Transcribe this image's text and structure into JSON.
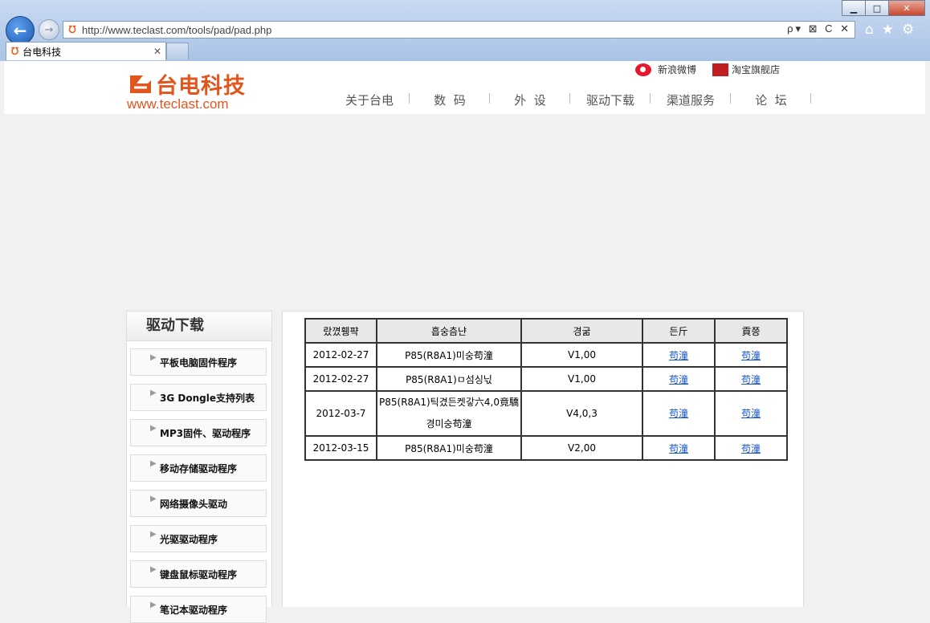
{
  "browser": {
    "url": "http://www.teclast.com/tools/pad/pad.php",
    "tab_title": "台电科技",
    "address_tools": "ρ▾ ⊠ C ✕",
    "window_controls": [
      "minimize",
      "maximize",
      "close"
    ]
  },
  "header": {
    "logo_cn": "台电科技",
    "logo_en": "www.teclast.com",
    "weibo": "新浪微博",
    "taobao": "淘宝旗舰店",
    "nav": [
      "关于台电",
      "数  码",
      "外  设",
      "驱动下载",
      "渠道服务",
      "论  坛"
    ]
  },
  "sidebar": {
    "title": "驱动下载",
    "items": [
      "平板电脑固件程序",
      "3G Dongle支持列表",
      "MP3固件、驱动程序",
      "移动存储驱动程序",
      "网络摄像头驱动",
      "光驱驱动程序",
      "键盘鼠标驱动程序",
      "笔记本驱动程序"
    ]
  },
  "table": {
    "headers": [
      "랐꼈휑퍅",
      "흡숭츰냔",
      "경굶",
      "든斤",
      "貢쯩"
    ],
    "rows": [
      {
        "date": "2012-02-27",
        "name": "P85(R8A1)미숭苟潼",
        "version": "V1,00",
        "l1": "苟潼",
        "l2": "苟潼"
      },
      {
        "date": "2012-02-27",
        "name": "P85(R8A1)ㅁ섬싱닋",
        "version": "V1,00",
        "l1": "苟潼",
        "l2": "苟潼"
      },
      {
        "date": "2012-03-7",
        "name": "P85(R8A1)틱겼든켓갛六4,0竟驕경미숭苟潼",
        "version": "V4,0,3",
        "l1": "苟潼",
        "l2": "苟潼"
      },
      {
        "date": "2012-03-15",
        "name": "P85(R8A1)미숭苟潼",
        "version": "V2,00",
        "l1": "苟潼",
        "l2": "苟潼"
      }
    ]
  }
}
